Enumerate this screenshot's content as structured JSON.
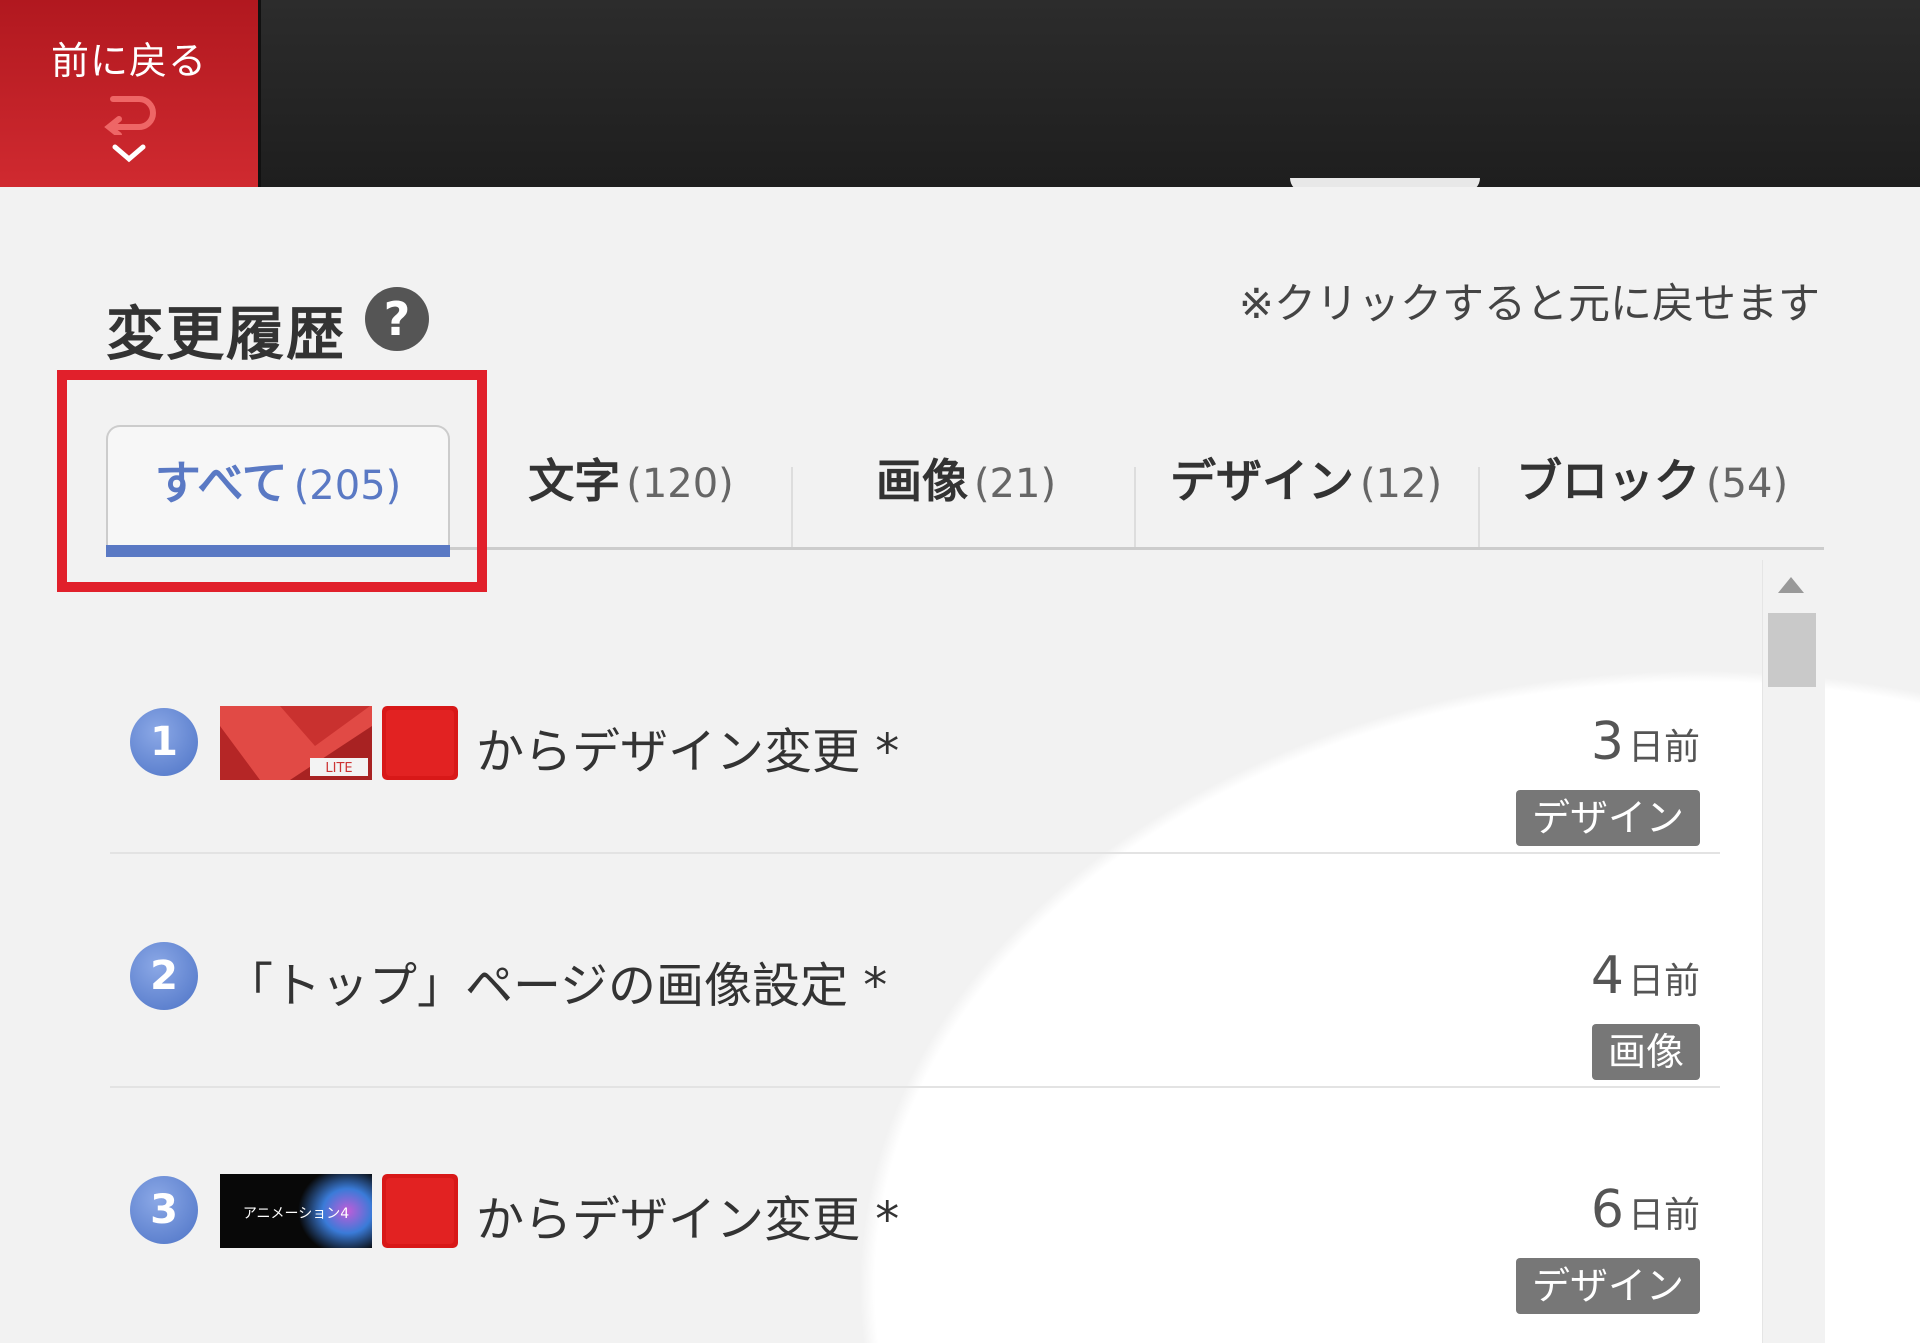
{
  "topbar": {
    "back_label": "前に戻る",
    "back_icon": "undo-arrow-icon",
    "chevron_icon": "chevron-down-icon"
  },
  "header": {
    "title": "変更履歴",
    "help_icon_glyph": "?",
    "hint": "※クリックすると元に戻せます"
  },
  "tabs": [
    {
      "label": "すべて",
      "count": "(205)",
      "active": true
    },
    {
      "label": "文字",
      "count": "(120)",
      "active": false
    },
    {
      "label": "画像",
      "count": "(21)",
      "active": false
    },
    {
      "label": "デザイン",
      "count": "(12)",
      "active": false
    },
    {
      "label": "ブロック",
      "count": "(54)",
      "active": false
    }
  ],
  "history": [
    {
      "num": "1",
      "text": "からデザイン変更 *",
      "ago_value": "3",
      "ago_unit": "日前",
      "badge": "デザイン",
      "thumb_label": "LITE"
    },
    {
      "num": "2",
      "text": "「トップ」ページの画像設定 *",
      "ago_value": "4",
      "ago_unit": "日前",
      "badge": "画像"
    },
    {
      "num": "3",
      "text": "からデザイン変更 *",
      "ago_value": "6",
      "ago_unit": "日前",
      "badge": "デザイン",
      "thumb_label": "アニメーション4"
    }
  ],
  "colors": {
    "accent_red": "#d02a30",
    "tab_active_blue": "#5a79c4",
    "highlight_box": "#e1202b",
    "badge_gray": "#777777"
  }
}
